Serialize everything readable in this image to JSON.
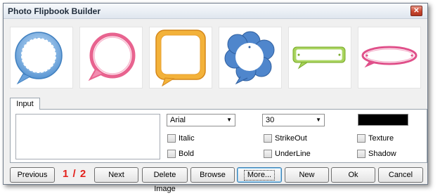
{
  "window": {
    "title": "Photo Flipbook Builder",
    "close_symbol": "✕"
  },
  "thumbnails": [
    {
      "name": "round-dotted-frame",
      "color": "#4f8fcf"
    },
    {
      "name": "pink-round-speech-bubble",
      "color": "#e8638f"
    },
    {
      "name": "orange-square-bubble",
      "color": "#f0a426"
    },
    {
      "name": "blue-flower-bubble",
      "color": "#3d76c0"
    },
    {
      "name": "green-rectangle-bubble",
      "color": "#8cc63f"
    },
    {
      "name": "pink-oval-bubble",
      "color": "#e0508a"
    }
  ],
  "tabs": {
    "input": "Input"
  },
  "input_panel": {
    "text_value": "",
    "font": "Arial",
    "size": "30",
    "text_color": "#000000",
    "checkboxes": {
      "italic": "Italic",
      "bold": "Bold",
      "strikeout": "StrikeOut",
      "underline": "UnderLine",
      "texture": "Texture",
      "shadow": "Shadow"
    }
  },
  "pager": {
    "current": "1",
    "separator": "/",
    "total": "2"
  },
  "buttons": {
    "previous": "Previous",
    "next": "Next",
    "delete_image": "Delete Image",
    "browse": "Browse",
    "more": "More...",
    "new": "New",
    "ok": "Ok",
    "cancel": "Cancel"
  }
}
